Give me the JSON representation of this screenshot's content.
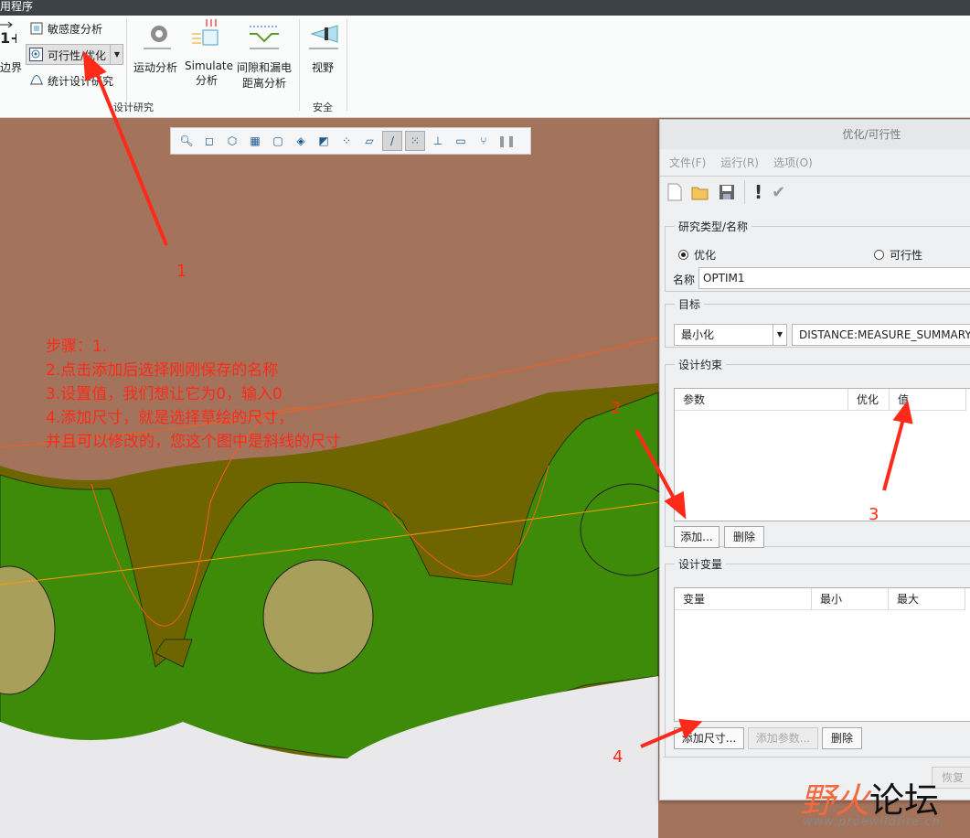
{
  "app": {
    "title": "用程序"
  },
  "ribbon": {
    "boundary": "边界",
    "sensitivity": "敏感度分析",
    "feasibility": "可行性/优化",
    "statistical": "统计设计研究",
    "motion": "运动分析",
    "simulate_1": "Simulate",
    "simulate_2": "分析",
    "clearance_1": "间隙和漏电",
    "clearance_2": "距离分析",
    "view": "视野",
    "group_design": "设计研究",
    "group_safety": "安全"
  },
  "viewport_toolbar": [
    "zoom",
    "saved-views",
    "display-style",
    "view-manager",
    "new-view",
    "perspective",
    "section",
    "datum-display",
    "plane-display",
    "axis-display",
    "point-display",
    "csys-display",
    "annotation-display",
    "spin-center",
    "pause"
  ],
  "annotations": {
    "steps": [
      "步骤：1.",
      "2.点击添加后选择刚刚保存的名称",
      "3.设置值，我们想让它为0，输入0",
      "4.添加尺寸，就是选择草绘的尺寸，",
      "并且可以修改的，您这个图中是斜线的尺寸"
    ],
    "n1": "1",
    "n2": "2",
    "n3": "3",
    "n4": "4"
  },
  "dialog": {
    "title": "优化/可行性",
    "menu": [
      "文件(F)",
      "运行(R)",
      "选项(O)"
    ],
    "study": {
      "legend": "研究类型/名称",
      "opt_label": "优化",
      "feas_label": "可行性",
      "selected": "优化",
      "name_label": "名称",
      "name_value": "OPTIM1"
    },
    "goal": {
      "legend": "目标",
      "mode": "最小化",
      "param": "DISTANCE:MEASURE_SUMMARY"
    },
    "constraints": {
      "legend": "设计约束",
      "columns": [
        "参数",
        "优化",
        "值"
      ],
      "add": "添加...",
      "delete": "删除"
    },
    "variables": {
      "legend": "设计变量",
      "columns": [
        "变量",
        "最小",
        "最大"
      ],
      "add_dim": "添加尺寸...",
      "add_param": "添加参数...",
      "delete": "删除"
    },
    "restore": "恢复"
  },
  "watermark": {
    "name_a": "野火",
    "name_b": "论坛",
    "url": "www.proewildfire.cn"
  },
  "colors": {
    "annotation": "#ff2a1a",
    "model_green": "#3e8b0a",
    "background_brown": "#a3735c"
  }
}
